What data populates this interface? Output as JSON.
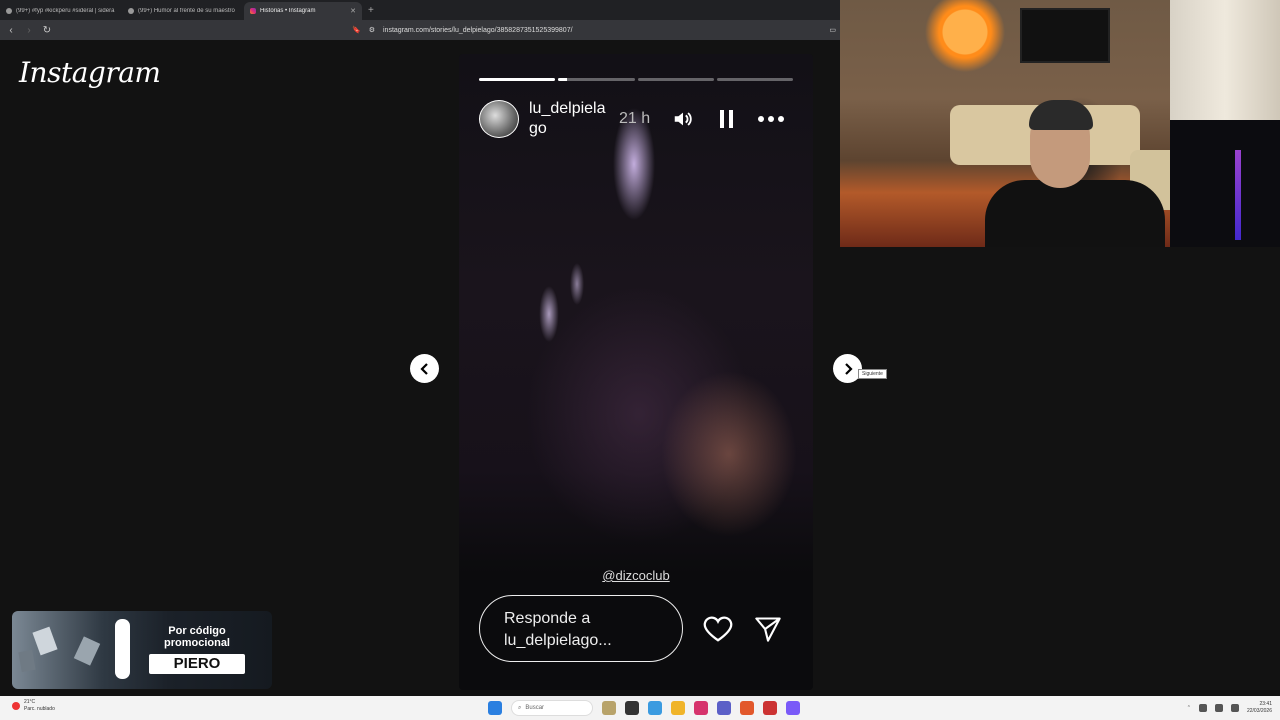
{
  "browser": {
    "tabs": [
      {
        "label": "(99+) #fyp #kickperu #sideral | sidera",
        "active": false,
        "icon": "tiktok-icon"
      },
      {
        "label": "(99+) Humor al frente de su maestro",
        "active": false,
        "icon": "tiktok-icon"
      },
      {
        "label": "Historias • Instagram",
        "active": true,
        "icon": "instagram-icon"
      }
    ],
    "new_tab": "+",
    "url": "instagram.com/stories/lu_delpielago/3858287351525399807/"
  },
  "page": {
    "logo": "Instagram",
    "story": {
      "progress": [
        1.0,
        0.12,
        0.0,
        0.0
      ],
      "username": "lu_delpielago",
      "time": "21 h",
      "mention": "@dizcoclub",
      "reply_placeholder": "Responde a lu_delpielago...",
      "next_tooltip": "Siguiente"
    }
  },
  "promo": {
    "title": "Por código promocional",
    "code": "PIERO"
  },
  "taskbar": {
    "weather_temp": "21°C",
    "weather_desc": "Parc. nublado",
    "search_placeholder": "Buscar",
    "time": "23:41",
    "date": "22/03/2026"
  }
}
